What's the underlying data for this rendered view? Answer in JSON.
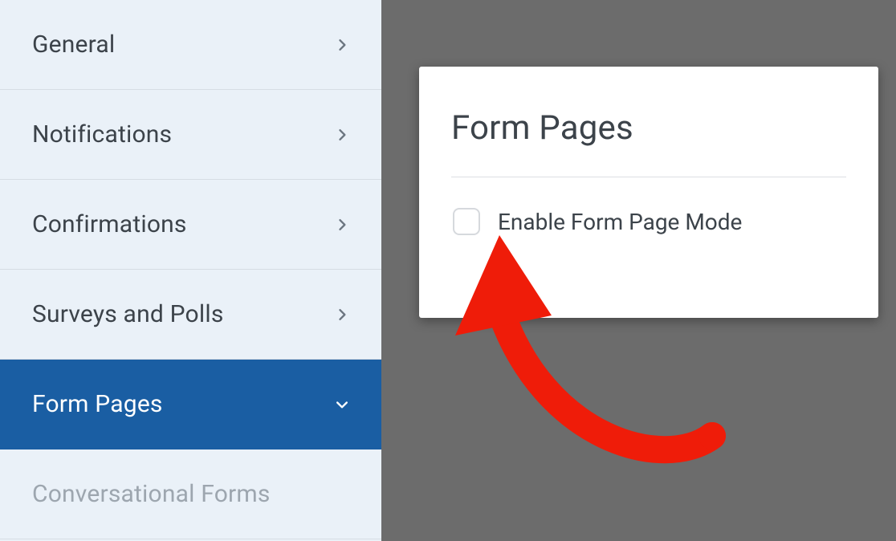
{
  "sidebar": {
    "items": [
      {
        "label": "General"
      },
      {
        "label": "Notifications"
      },
      {
        "label": "Confirmations"
      },
      {
        "label": "Surveys and Polls"
      },
      {
        "label": "Form Pages"
      },
      {
        "label": "Conversational Forms"
      }
    ]
  },
  "panel": {
    "title": "Form Pages",
    "checkbox_label": "Enable Form Page Mode"
  }
}
